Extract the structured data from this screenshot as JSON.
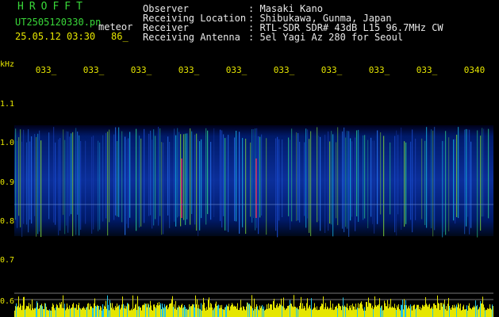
{
  "header": {
    "brand": "HROFFT",
    "filename": "UT2505120330.pn",
    "tag": "meteor",
    "date_time": "25.05.12 03:30",
    "number": "86_"
  },
  "info": [
    {
      "label": "Observer",
      "value": ": Masaki Kano"
    },
    {
      "label": "Receiving Location",
      "value": ": Shibukawa, Gunma, Japan"
    },
    {
      "label": "Receiver",
      "value": ": RTL-SDR SDR# 43dB L15 96.7MHz CW"
    },
    {
      "label": "Receiving Antenna",
      "value": ": 5el Yagi Az 280 for Seoul"
    }
  ],
  "axis": {
    "y_unit": "kHz",
    "y_ticks": [
      "1.1",
      "1.0",
      "0.9",
      "0.8",
      "0.7",
      "0.6"
    ],
    "x_ticks": [
      "033_",
      "033_",
      "033_",
      "033_",
      "033_",
      "033_",
      "033_",
      "033_",
      "033_",
      "0340"
    ]
  },
  "colors": {
    "background": "#000000",
    "label_yellow": "#e6e600",
    "brand_green": "#39d839",
    "text_white": "#e8e8e8"
  }
}
